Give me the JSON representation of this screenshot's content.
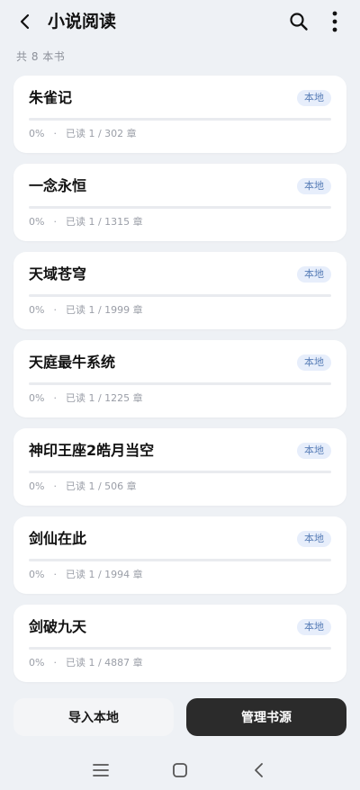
{
  "header": {
    "title": "小说阅读",
    "back_icon": "chevron-left-icon",
    "search_icon": "search-icon",
    "more_icon": "more-vertical-icon"
  },
  "summary": {
    "count_text": "共 8 本书"
  },
  "books": [
    {
      "title": "朱雀记",
      "badge": "本地",
      "percent": "0%",
      "sep": "·",
      "progress_text": "已读 1 / 302 章",
      "progress": 0
    },
    {
      "title": "一念永恒",
      "badge": "本地",
      "percent": "0%",
      "sep": "·",
      "progress_text": "已读 1 / 1315 章",
      "progress": 0
    },
    {
      "title": "天域苍穹",
      "badge": "本地",
      "percent": "0%",
      "sep": "·",
      "progress_text": "已读 1 / 1999 章",
      "progress": 0
    },
    {
      "title": "天庭最牛系统",
      "badge": "本地",
      "percent": "0%",
      "sep": "·",
      "progress_text": "已读 1 / 1225 章",
      "progress": 0
    },
    {
      "title": "神印王座2皓月当空",
      "badge": "本地",
      "percent": "0%",
      "sep": "·",
      "progress_text": "已读 1 / 506 章",
      "progress": 0
    },
    {
      "title": "剑仙在此",
      "badge": "本地",
      "percent": "0%",
      "sep": "·",
      "progress_text": "已读 1 / 1994 章",
      "progress": 0
    },
    {
      "title": "剑破九天",
      "badge": "本地",
      "percent": "0%",
      "sep": "·",
      "progress_text": "已读 1 / 4887 章",
      "progress": 0
    }
  ],
  "actions": {
    "import_label": "导入本地",
    "manage_label": "管理书源"
  },
  "colors": {
    "background": "#eef1f5",
    "accent": "#5a7fb8",
    "badge_bg": "#e7eefb",
    "primary_button": "#2b2b2b"
  },
  "system_nav": {
    "menu_icon": "menu-icon",
    "home_icon": "home-square-icon",
    "back_icon": "back-chevron-icon"
  }
}
